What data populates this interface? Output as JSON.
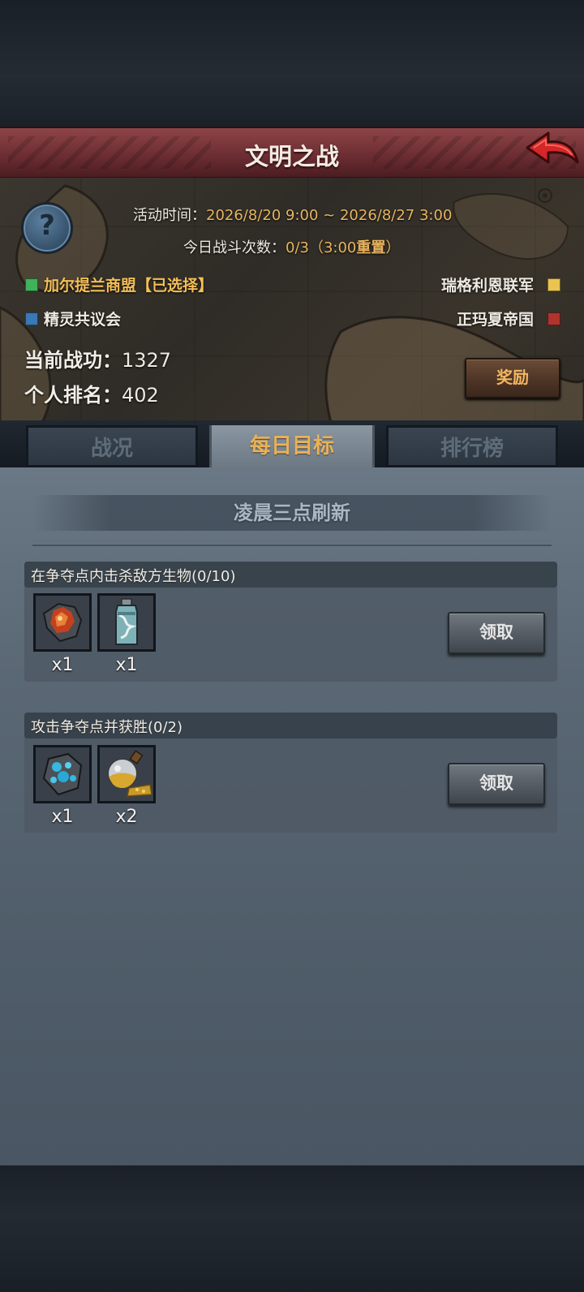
{
  "header": {
    "title": "文明之战"
  },
  "event": {
    "time_label": "活动时间：",
    "time_value": "2026/8/20 9:00 ~ 2026/8/27 3:00",
    "battles_label": "今日战斗次数：",
    "battles_value": "0/3",
    "reset_open": "（3:00",
    "reset_word": "重置",
    "reset_close": "）"
  },
  "factions": [
    {
      "name": "加尔提兰商盟【已选择】",
      "color": "#3fb25a",
      "selected": true
    },
    {
      "name": "瑞格利恩联军",
      "color": "#e9c450",
      "selected": false
    },
    {
      "name": "精灵共议会",
      "color": "#3a78b6",
      "selected": false
    },
    {
      "name": "正玛夏帝国",
      "color": "#b0342e",
      "selected": false
    }
  ],
  "stats": {
    "merit_label": "当前战功：",
    "merit_value": "1327",
    "rank_label": "个人排名：",
    "rank_value": "402"
  },
  "reward_button": "奖励",
  "tabs": [
    {
      "label": "战况",
      "active": false
    },
    {
      "label": "每日目标",
      "active": true
    },
    {
      "label": "排行榜",
      "active": false
    }
  ],
  "refresh_text": "凌晨三点刷新",
  "tasks": [
    {
      "title": "在争夺点内击杀敌方生物(0/10)",
      "claim_label": "领取",
      "items": [
        {
          "icon": "red-ore-crystal-icon",
          "qty": "x1"
        },
        {
          "icon": "blue-potion-bottle-icon",
          "qty": "x1"
        }
      ]
    },
    {
      "title": "攻击争夺点并获胜(0/2)",
      "claim_label": "领取",
      "items": [
        {
          "icon": "blue-gem-ore-icon",
          "qty": "x1"
        },
        {
          "icon": "gold-flask-icon",
          "qty": "x2"
        }
      ]
    }
  ],
  "colors": {
    "title_bar": "#6d2e33",
    "accent_gold": "#e8b560",
    "active_tab_text": "#eab156",
    "panel": "#5a6774"
  }
}
